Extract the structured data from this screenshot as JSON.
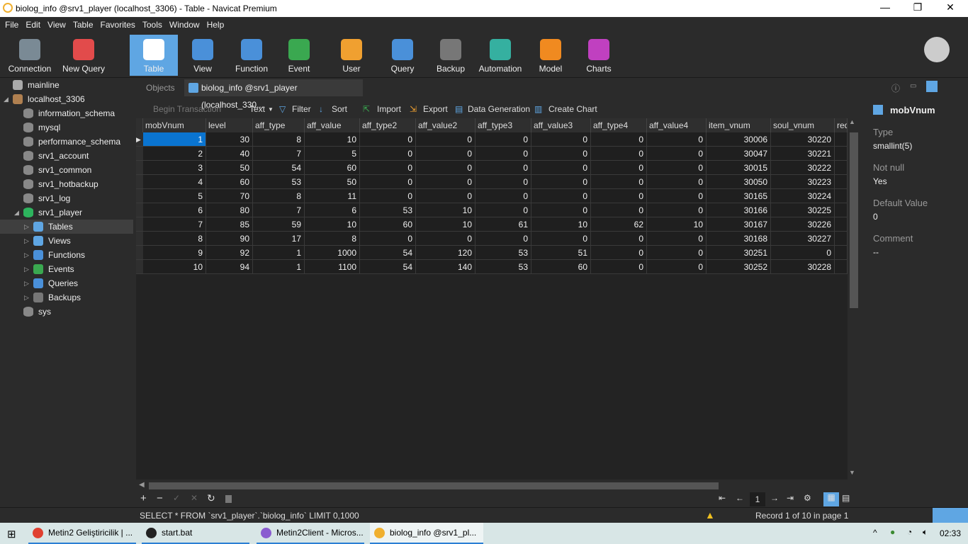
{
  "window": {
    "title": "biolog_info @srv1_player (localhost_3306) - Table - Navicat Premium",
    "minimize": "—",
    "maximize": "❐",
    "close": "✕"
  },
  "menu": [
    "File",
    "Edit",
    "View",
    "Table",
    "Favorites",
    "Tools",
    "Window",
    "Help"
  ],
  "toolbar": [
    {
      "label": "Connection",
      "icon": "connection-icon",
      "color": "#7a8a95"
    },
    {
      "label": "New Query",
      "icon": "new-query-icon",
      "color": "#e24b4b"
    },
    {
      "label": "Table",
      "icon": "table-icon",
      "color": "#ffffff",
      "active": true
    },
    {
      "label": "View",
      "icon": "view-icon",
      "color": "#4a90d9"
    },
    {
      "label": "Function",
      "icon": "function-icon",
      "color": "#4a90d9"
    },
    {
      "label": "Event",
      "icon": "event-icon",
      "color": "#3aa850"
    },
    {
      "label": "User",
      "icon": "user-icon",
      "color": "#f0a030"
    },
    {
      "label": "Query",
      "icon": "query-icon",
      "color": "#4a90d9"
    },
    {
      "label": "Backup",
      "icon": "backup-icon",
      "color": "#777777"
    },
    {
      "label": "Automation",
      "icon": "automation-icon",
      "color": "#35b0a0"
    },
    {
      "label": "Model",
      "icon": "model-icon",
      "color": "#f08a20"
    },
    {
      "label": "Charts",
      "icon": "charts-icon",
      "color": "#c040c0"
    }
  ],
  "sidebar": [
    {
      "label": "mainline",
      "icon": "connection-icon",
      "level": 0,
      "color": "#aaaaaa"
    },
    {
      "label": "localhost_3306",
      "icon": "connection-icon",
      "level": 0,
      "expanded": true,
      "color": "#b08050"
    },
    {
      "label": "information_schema",
      "icon": "database-icon",
      "level": 1,
      "color": "#888888"
    },
    {
      "label": "mysql",
      "icon": "database-icon",
      "level": 1,
      "color": "#888888"
    },
    {
      "label": "performance_schema",
      "icon": "database-icon",
      "level": 1,
      "color": "#888888"
    },
    {
      "label": "srv1_account",
      "icon": "database-icon",
      "level": 1,
      "color": "#888888"
    },
    {
      "label": "srv1_common",
      "icon": "database-icon",
      "level": 1,
      "color": "#888888"
    },
    {
      "label": "srv1_hotbackup",
      "icon": "database-icon",
      "level": 1,
      "color": "#888888"
    },
    {
      "label": "srv1_log",
      "icon": "database-icon",
      "level": 1,
      "color": "#888888"
    },
    {
      "label": "srv1_player",
      "icon": "database-icon",
      "level": 1,
      "expanded": true,
      "color": "#2db35d"
    },
    {
      "label": "Tables",
      "icon": "table-icon",
      "level": 2,
      "selected": true,
      "color": "#5fa6e3"
    },
    {
      "label": "Views",
      "icon": "view-icon",
      "level": 2,
      "color": "#5fa6e3"
    },
    {
      "label": "Functions",
      "icon": "function-icon",
      "level": 2,
      "color": "#4a90d9"
    },
    {
      "label": "Events",
      "icon": "event-icon",
      "level": 2,
      "color": "#3aa850"
    },
    {
      "label": "Queries",
      "icon": "query-icon",
      "level": 2,
      "color": "#4a90d9"
    },
    {
      "label": "Backups",
      "icon": "backup-icon",
      "level": 2,
      "color": "#777777"
    },
    {
      "label": "sys",
      "icon": "database-icon",
      "level": 1,
      "color": "#888888"
    }
  ],
  "tabs": {
    "objects": "Objects",
    "active": "biolog_info @srv1_player (localhost_330..."
  },
  "subtoolbar": {
    "begin_transaction": "Begin Transaction",
    "text": "Text",
    "filter": "Filter",
    "sort": "Sort",
    "import": "Import",
    "export": "Export",
    "data_generation": "Data Generation",
    "create_chart": "Create Chart"
  },
  "grid": {
    "columns": [
      "mobVnum",
      "level",
      "aff_type",
      "aff_value",
      "aff_type2",
      "aff_value2",
      "aff_type3",
      "aff_value3",
      "aff_type4",
      "aff_value4",
      "item_vnum",
      "soul_vnum",
      "req"
    ],
    "rows": [
      [
        "1",
        "30",
        "8",
        "10",
        "0",
        "0",
        "0",
        "0",
        "0",
        "0",
        "30006",
        "30220"
      ],
      [
        "2",
        "40",
        "7",
        "5",
        "0",
        "0",
        "0",
        "0",
        "0",
        "0",
        "30047",
        "30221"
      ],
      [
        "3",
        "50",
        "54",
        "60",
        "0",
        "0",
        "0",
        "0",
        "0",
        "0",
        "30015",
        "30222"
      ],
      [
        "4",
        "60",
        "53",
        "50",
        "0",
        "0",
        "0",
        "0",
        "0",
        "0",
        "30050",
        "30223"
      ],
      [
        "5",
        "70",
        "8",
        "11",
        "0",
        "0",
        "0",
        "0",
        "0",
        "0",
        "30165",
        "30224"
      ],
      [
        "6",
        "80",
        "7",
        "6",
        "53",
        "10",
        "0",
        "0",
        "0",
        "0",
        "30166",
        "30225"
      ],
      [
        "7",
        "85",
        "59",
        "10",
        "60",
        "10",
        "61",
        "10",
        "62",
        "10",
        "30167",
        "30226"
      ],
      [
        "8",
        "90",
        "17",
        "8",
        "0",
        "0",
        "0",
        "0",
        "0",
        "0",
        "30168",
        "30227"
      ],
      [
        "9",
        "92",
        "1",
        "1000",
        "54",
        "120",
        "53",
        "51",
        "0",
        "0",
        "30251",
        "0"
      ],
      [
        "10",
        "94",
        "1",
        "1100",
        "54",
        "140",
        "53",
        "60",
        "0",
        "0",
        "30252",
        "30228"
      ]
    ]
  },
  "pager": {
    "page": "1"
  },
  "field_info": {
    "name": "mobVnum",
    "type_label": "Type",
    "type": "smallint(5)",
    "notnull_label": "Not null",
    "notnull": "Yes",
    "default_label": "Default Value",
    "default": "0",
    "comment_label": "Comment",
    "comment": "--"
  },
  "status": {
    "sql": "SELECT * FROM `srv1_player`.`biolog_info` LIMIT 0,1000",
    "record": "Record 1 of 10 in page 1"
  },
  "taskbar": {
    "items": [
      {
        "label": "Metin2 Geliştiricilik | ...",
        "color": "#e04030"
      },
      {
        "label": "start.bat",
        "color": "#222222"
      },
      {
        "label": "Metin2Client - Micros...",
        "color": "#8a5cd0"
      },
      {
        "label": "biolog_info @srv1_pl...",
        "color": "#f0b030"
      }
    ],
    "time": "02:33"
  }
}
